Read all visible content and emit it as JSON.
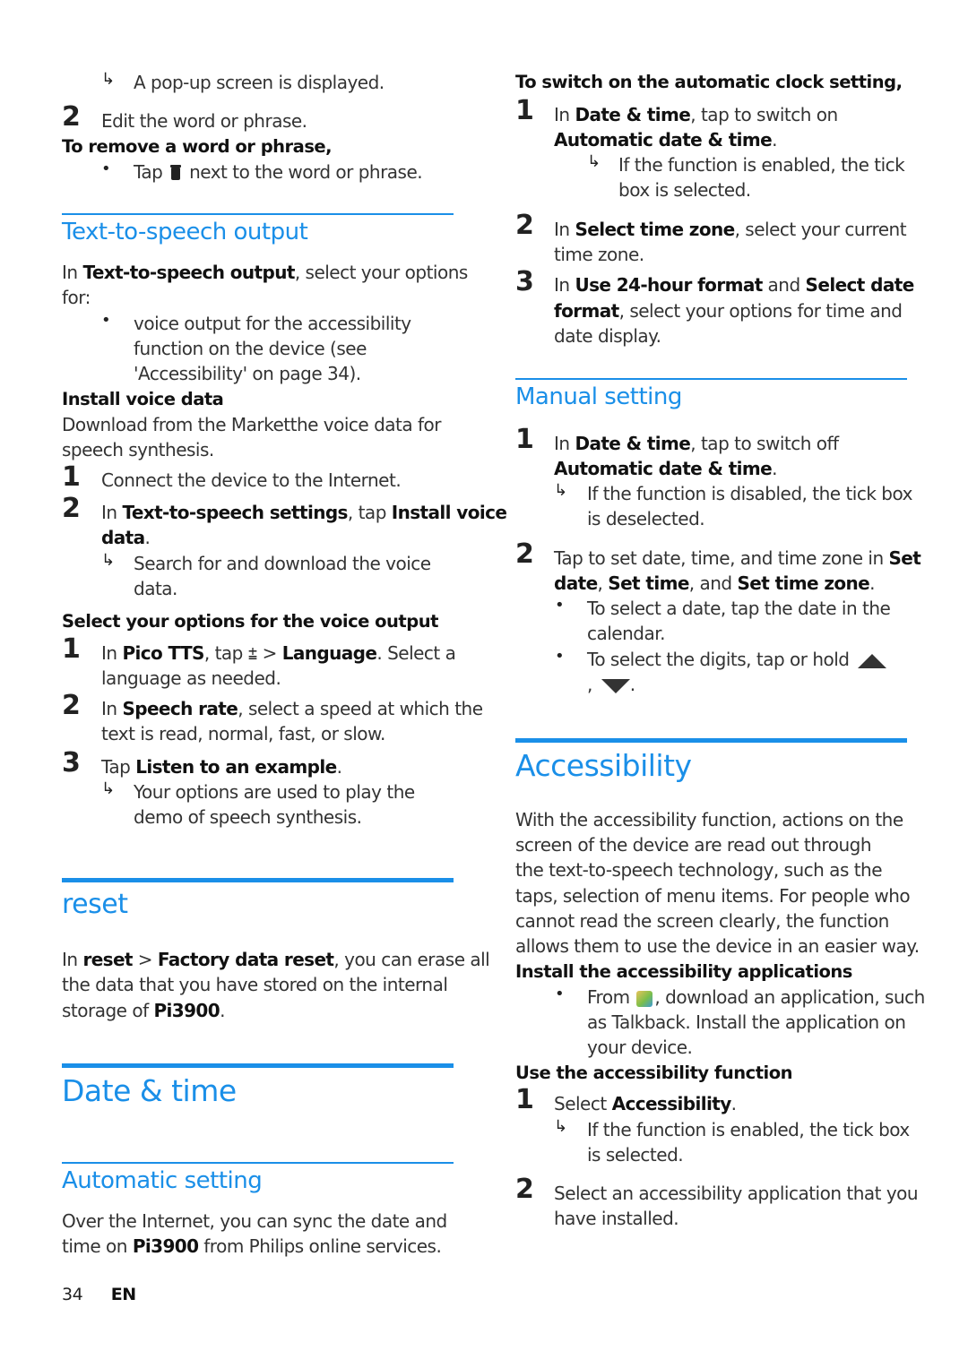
{
  "left": {
    "intro": {
      "result_popup": "A pop-up screen is displayed.",
      "step2_num": "2",
      "step2_text": "Edit the word or phrase.",
      "remove_label": "To remove a word or phrase,",
      "remove_bullet_pre": "Tap",
      "remove_bullet_post": "next to the word or phrase."
    },
    "tts": {
      "heading": "Text-to-speech output",
      "intro_pre": "In",
      "intro_bold": "Text-to-speech output",
      "intro_post_line1": ", select your options",
      "intro_line2": "for:",
      "bullet_lines": [
        "voice output for the accessibility",
        "function on the device (see",
        "'Accessibility' on page 34)."
      ],
      "install_label": "Install voice data",
      "install_desc_lines": [
        "Download from the Marketthe voice data for",
        "speech synthesis."
      ],
      "install_steps": [
        {
          "num": "1",
          "text": "Connect the device to the Internet."
        },
        {
          "num": "2",
          "pre": "In",
          "bold1": "Text-to-speech settings",
          "mid": ", tap",
          "bold2": "Install voice",
          "bold3": "data",
          "post": "."
        }
      ],
      "install_result_lines": [
        "Search for and download the voice",
        "data."
      ],
      "options_label": "Select your options for the voice output",
      "options_steps": [
        {
          "num": "1",
          "pre": "In",
          "bold1": "Pico TTS",
          "mid": ", tap",
          "sep": ">",
          "bold2": "Language",
          "post": ". Select a",
          "line2": "language as needed."
        },
        {
          "num": "2",
          "pre": "In",
          "bold1": "Speech rate",
          "post": ", select a speed at which the",
          "line2": "text is read, normal, fast, or slow."
        },
        {
          "num": "3",
          "pre": "Tap",
          "bold1": "Listen to an example",
          "post": "."
        }
      ],
      "options_result_lines": [
        "Your options are used to play the",
        "demo of speech synthesis."
      ]
    },
    "reset": {
      "heading": "reset",
      "pre": "In",
      "bold1": "reset",
      "sep": ">",
      "bold2": "Factory data reset",
      "post": ", you can erase all",
      "line2": "the data that you have stored on the internal",
      "line3_pre": "storage of",
      "line3_bold": "Pi3900",
      "line3_post": "."
    },
    "datetime": {
      "heading": "Date & time",
      "auto_heading": "Automatic setting",
      "auto_line1": "Over the Internet, you can sync the date and",
      "auto_line2_pre": "time on",
      "auto_line2_bold": "Pi3900",
      "auto_line2_post": "from Philips online services."
    }
  },
  "right": {
    "auto_clock": {
      "label": "To switch on the automatic clock setting,",
      "step1": {
        "num": "1",
        "pre": "In",
        "bold1": "Date & time",
        "post": ", tap to switch on",
        "bold2": "Automatic date & time",
        "post2": "."
      },
      "step1_result_lines": [
        "If the function is enabled, the tick",
        "box is selected."
      ],
      "step2": {
        "num": "2",
        "pre": "In",
        "bold1": "Select time zone",
        "post": ", select your current",
        "line2": "time zone."
      },
      "step3": {
        "num": "3",
        "pre": "In",
        "bold1": "Use 24-hour format",
        "mid": "and",
        "bold2": "Select date",
        "bold3": "format",
        "post": ", select your options for time and",
        "line3": "date display."
      }
    },
    "manual": {
      "heading": "Manual setting",
      "step1": {
        "num": "1",
        "pre": "In",
        "bold1": "Date & time",
        "post": ", tap to switch off",
        "bold2": "Automatic date & time",
        "post2": "."
      },
      "step1_result_lines": [
        "If the function is disabled, the tick box",
        "is deselected."
      ],
      "step2": {
        "num": "2",
        "pre": "Tap to set date, time, and time zone in",
        "bold1": "Set",
        "bold1b": "date",
        "sep1": ",",
        "bold2": "Set time",
        "mid": ", and",
        "bold3": "Set time zone",
        "post": "."
      },
      "bullets": [
        {
          "lines": [
            "To select a date, tap the date in the",
            "calendar."
          ]
        },
        {
          "pre": "To select the digits, tap or hold",
          "comma": ",",
          "end": "."
        }
      ]
    },
    "accessibility": {
      "heading": "Accessibility",
      "intro_lines": [
        "With the accessibility function, actions on the",
        "screen of the device are read out through",
        "the text-to-speech technology, such as the",
        "taps, selection of menu items. For people who",
        "cannot read the screen clearly, the function",
        "allows them to use the device in an easier way."
      ],
      "install_label": "Install the accessibility applications",
      "install_bullet": {
        "pre": "From",
        "post": ", download an application, such",
        "line2": "as Talkback. Install the application on",
        "line3": "your device."
      },
      "use_label": "Use the accessibility function",
      "step1": {
        "num": "1",
        "pre": "Select",
        "bold1": "Accessibility",
        "post": "."
      },
      "step1_result_lines": [
        "If the function is enabled, the tick box",
        "is selected."
      ],
      "step2": {
        "num": "2",
        "line1": "Select an accessibility application that you",
        "line2": "have installed."
      }
    }
  },
  "footer": {
    "page_number": "34",
    "language": "EN"
  },
  "glyphs": {
    "arrow": "↳",
    "bullet": "•"
  },
  "colors": {
    "accent": "#1a8fe8",
    "text": "#333333"
  }
}
